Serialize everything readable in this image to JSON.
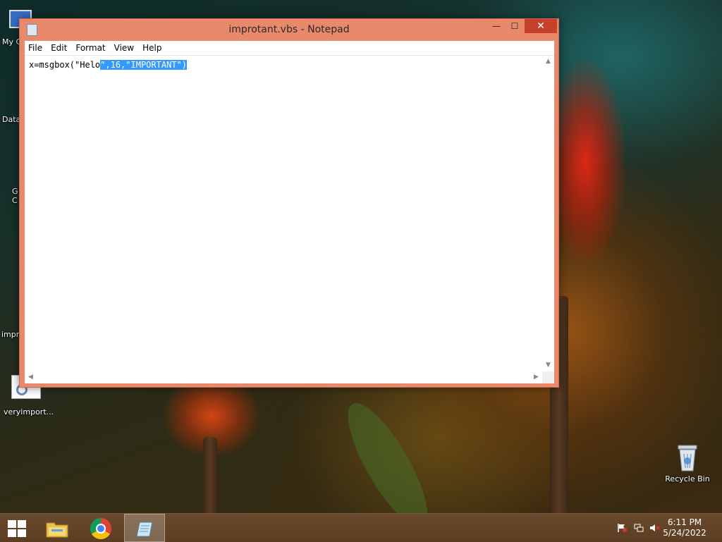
{
  "desktop": {
    "icons": [
      {
        "label": "My C"
      },
      {
        "label": "Data"
      },
      {
        "label": "G\nC"
      },
      {
        "label": "impr"
      },
      {
        "label": "veryimport..."
      },
      {
        "label": "Recycle Bin"
      }
    ]
  },
  "window": {
    "title": "improtant.vbs - Notepad",
    "controls": {
      "minimize": "—",
      "maximize": "☐",
      "close": "✕"
    },
    "menu": [
      "File",
      "Edit",
      "Format",
      "View",
      "Help"
    ],
    "editor": {
      "text_before_selection": "x=msgbox(\"Helo",
      "text_selected": "\",16,\"IMPORTANT\")"
    }
  },
  "taskbar": {
    "clock_time": "6:11 PM",
    "clock_date": "5/24/2022"
  },
  "colors": {
    "window_frame": "#e8896b",
    "close_button": "#c7402c",
    "selection": "#3399ff",
    "taskbar": "#5a3d22"
  },
  "icons": {
    "start": "windows-logo-icon",
    "explorer": "folder-icon",
    "chrome": "chrome-icon",
    "notepad": "notepad-icon",
    "tray_flag": "action-center-flag-icon",
    "tray_network": "network-icon",
    "tray_volume": "volume-muted-icon"
  }
}
